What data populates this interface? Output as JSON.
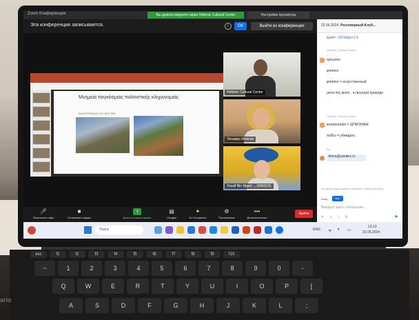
{
  "window": {
    "title": "Zoom Конференция",
    "share_banner": "Вы демонстрируете экран Hellenic Cultural Center",
    "view_settings": "Настройки просмотра"
  },
  "recording_bar": {
    "text": "Эта конференция записывается.",
    "ok_label": "OK",
    "exit_label": "Выйти из конференции"
  },
  "slide": {
    "title": "Μνημεία παγκόσμιας πολιτιστικής κληρονομιάς",
    "subtitle": "ΚΑΣΤΡΟΠΟΛΗ ΤΟΥ ΜΥΣΤΡΑ"
  },
  "participants": [
    {
      "label": "Hellenic Cultural Center"
    },
    {
      "label": "Эльвира Моисеи"
    },
    {
      "label": "Yousif Bin Nigeri ... GREECE"
    }
  ],
  "toolbar": {
    "items": [
      {
        "icon": "microphone-icon",
        "label": "Выключить звук"
      },
      {
        "icon": "video-icon",
        "label": "Остановить видео"
      },
      {
        "icon": "share-screen-icon",
        "label": "Демонстрация экрана"
      },
      {
        "icon": "whiteboard-icon",
        "label": "Сводка"
      },
      {
        "icon": "ai-companion-icon",
        "label": "AI Companion"
      },
      {
        "icon": "apps-icon",
        "label": "Приложения"
      },
      {
        "icon": "more-icon",
        "label": "Дополнительно"
      }
    ],
    "leave_label": "Выйти"
  },
  "chat": {
    "date": "22.06.2024",
    "title": "Разговорный-Клуб...",
    "link": "&pid=...557&dpr=1.5",
    "messages": [
      {
        "sender": "Hellenic Cultural Center",
        "lines": [
          "αρτώσκο",
          "φτιάσκο",
          "φτιάσκο = искусственный",
          "μέσα στη φύση - в (внутри) природе"
        ]
      },
      {
        "sender": "Hellenic Cultural Center",
        "lines": [
          "κατασκοπεία = ШПИОНАЖ",
          "πείθω = убеждать"
        ]
      },
      {
        "sender": "Вы",
        "lines": [
          "dorka@yandex.ru"
        ]
      }
    ],
    "note": "Кто может видеть ваши сообщения? Запись доступна",
    "recipient_label": "Кому:",
    "recipient": "Все",
    "input_placeholder": "Введите здесь сообщение..."
  },
  "taskbar": {
    "search_placeholder": "Поиск",
    "lang": "ENG",
    "time": "13:13",
    "date": "22.06.2024"
  },
  "keyboard": {
    "fn_row": [
      "esc",
      "f1",
      "f2",
      "f3",
      "f4",
      "f5",
      "f6",
      "f7",
      "f8",
      "f9",
      "f10"
    ],
    "num_row": [
      "~",
      "1",
      "2",
      "3",
      "4",
      "5",
      "6",
      "7",
      "8",
      "9",
      "0",
      "-"
    ],
    "top_row": [
      "Q",
      "W",
      "E",
      "R",
      "T",
      "Y",
      "U",
      "I",
      "O",
      "P",
      "["
    ],
    "home_row": [
      "A",
      "S",
      "D",
      "F",
      "G",
      "H",
      "J",
      "K",
      "L",
      ";"
    ],
    "brand": "ario"
  }
}
